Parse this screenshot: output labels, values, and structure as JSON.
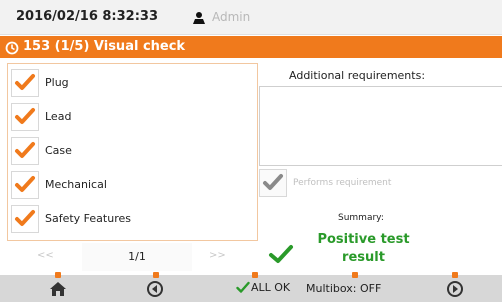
{
  "header": {
    "datetime": "2016/02/16 8:32:33",
    "user": "Admin"
  },
  "title": {
    "text": "153 (1/5) Visual check"
  },
  "checklist": {
    "items": [
      {
        "label": "Plug",
        "checked": true
      },
      {
        "label": "Lead",
        "checked": true
      },
      {
        "label": "Case",
        "checked": true
      },
      {
        "label": "Mechanical",
        "checked": true
      },
      {
        "label": "Safety Features",
        "checked": true
      }
    ],
    "pager": {
      "prev": "<<",
      "page": "1/1",
      "next": ">>"
    }
  },
  "requirements": {
    "label": "Additional requirements:",
    "value": "",
    "performs_label": "Performs requirement"
  },
  "summary": {
    "label": "Summary:",
    "result_line1": "Positive test",
    "result_line2": "result"
  },
  "footer": {
    "allok_label": "ALL OK",
    "multibox_label": "Multibox: OFF"
  },
  "colors": {
    "accent": "#f07a1c",
    "positive": "#2a9a2a",
    "check": "#f07a1c",
    "disabled_check": "#8a8a8a"
  },
  "icons": {
    "user": "user-icon",
    "title": "visual-check-icon",
    "home": "home-icon",
    "back": "back-icon",
    "forward": "forward-icon",
    "allok": "check-icon"
  }
}
